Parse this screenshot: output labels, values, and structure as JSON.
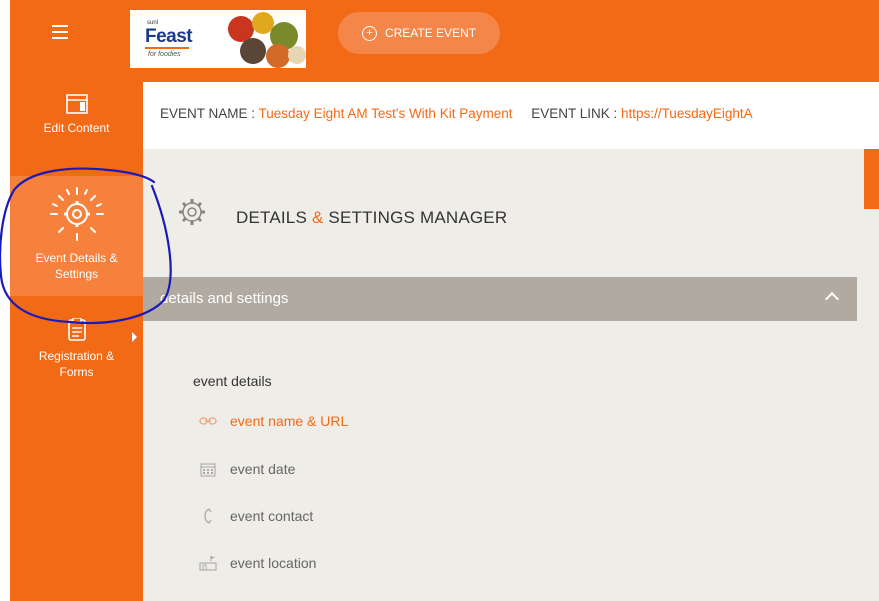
{
  "app": {
    "logo": {
      "small_text": "sunl",
      "brand": "Feast",
      "tagline": "for foodies"
    },
    "create_event_label": "CREATE EVENT"
  },
  "sidebar": {
    "items": [
      {
        "label": "Edit Content",
        "icon": "layout-icon",
        "active": false
      },
      {
        "label": "Event Details & Settings",
        "icon": "gear-sun-icon",
        "active": true
      },
      {
        "label": "Registration & Forms",
        "icon": "form-icon",
        "active": false,
        "has_submenu": true
      }
    ]
  },
  "infobar": {
    "event_name_label": "EVENT NAME :",
    "event_name_value": "Tuesday Eight AM Test's With Kit Payment",
    "event_link_label": "EVENT LINK :",
    "event_link_value": "https://TuesdayEightA"
  },
  "page": {
    "title_part1": "DETAILS",
    "title_amp": "&",
    "title_part2": "SETTINGS MANAGER"
  },
  "section": {
    "label": "details and settings",
    "expanded": true
  },
  "details": {
    "group_label": "event details",
    "items": [
      {
        "label": "event name & URL",
        "icon": "link-icon",
        "active": true
      },
      {
        "label": "event date",
        "icon": "calendar-icon",
        "active": false
      },
      {
        "label": "event contact",
        "icon": "phone-icon",
        "active": false
      },
      {
        "label": "event location",
        "icon": "location-icon",
        "active": false
      }
    ]
  },
  "colors": {
    "brand_orange": "#f26a16",
    "active_orange": "#f5813d",
    "section_bar": "#b0aaa0",
    "content_bg": "#efede8",
    "annotation_blue": "#1a1ab8"
  }
}
